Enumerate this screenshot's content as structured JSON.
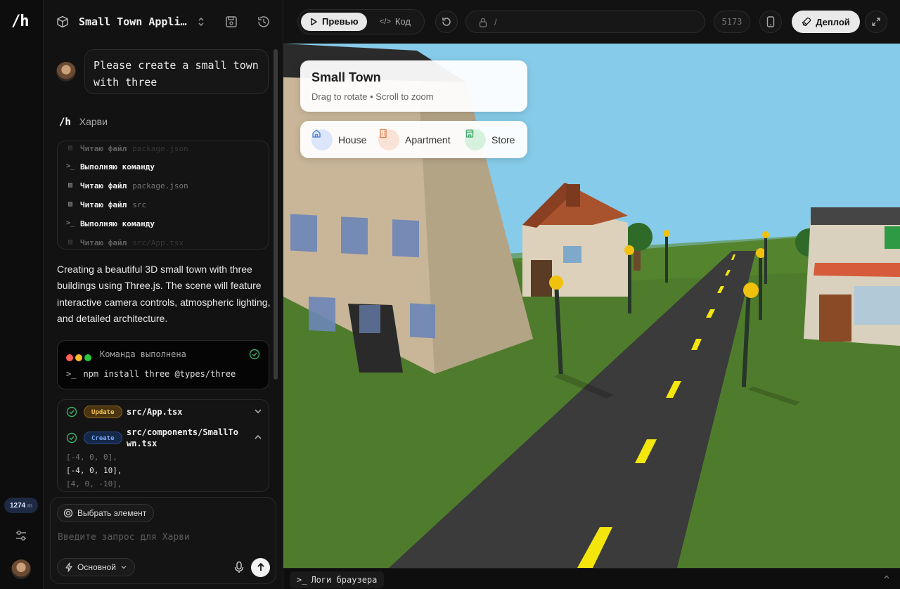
{
  "rail": {
    "logo": "/h",
    "credits_value": "1274",
    "credits_unit": "m"
  },
  "chat": {
    "project_title": "Small Town Appli…",
    "user_message": "Please create a small town with three",
    "agent_logo": "/h",
    "agent_name": "Харви",
    "steps": [
      {
        "icon": "file-icon",
        "label": "Читаю файл",
        "arg": "package.json"
      },
      {
        "icon": "terminal-icon",
        "label": "Выполняю команду",
        "arg": ""
      },
      {
        "icon": "file-icon",
        "label": "Читаю файл",
        "arg": "package.json"
      },
      {
        "icon": "file-icon",
        "label": "Читаю файл",
        "arg": "src"
      },
      {
        "icon": "terminal-icon",
        "label": "Выполняю команду",
        "arg": ""
      },
      {
        "icon": "file-icon",
        "label": "Читаю файл",
        "arg": "src/App.tsx"
      }
    ],
    "description": "Creating a beautiful 3D small town with three buildings using Three.js. The scene will feature interactive camera controls, atmospheric lighting, and detailed architecture.",
    "terminal": {
      "status": "Команда выполнена",
      "prompt": ">_",
      "command": "npm install three @types/three"
    },
    "files": [
      {
        "badge": "Update",
        "path": "src/App.tsx",
        "expanded": false
      },
      {
        "badge": "Create",
        "path_line1": "src/components/SmallTo",
        "path_line2": "wn.tsx",
        "expanded": true
      }
    ],
    "code_lines": [
      "[-4, 0, 0],",
      "[-4, 0, 10],",
      "[4, 0, -10],"
    ],
    "composer": {
      "pick_label": "Выбрать элемент",
      "placeholder": "Введите запрос для Харви",
      "mode_label": "Основной"
    }
  },
  "toolbar": {
    "preview_label": "Превью",
    "code_label": "Код",
    "url_path": "/",
    "port": "5173",
    "deploy_label": "Деплой"
  },
  "scene": {
    "title": "Small Town",
    "subtitle": "Drag to rotate • Scroll to zoom",
    "building_types": [
      {
        "label": "House",
        "color": "#4a7bd0",
        "bg": "#dbe6fb"
      },
      {
        "label": "Apartment",
        "color": "#e07a45",
        "bg": "#fbe2d6"
      },
      {
        "label": "Store",
        "color": "#3fa866",
        "bg": "#d7f1df"
      }
    ]
  },
  "logs": {
    "label": "Логи браузера"
  },
  "colors": {
    "sky": "#86cbe9",
    "grass": "#4f7c2c",
    "road": "#3b3b3b",
    "lane": "#f4e60c"
  }
}
